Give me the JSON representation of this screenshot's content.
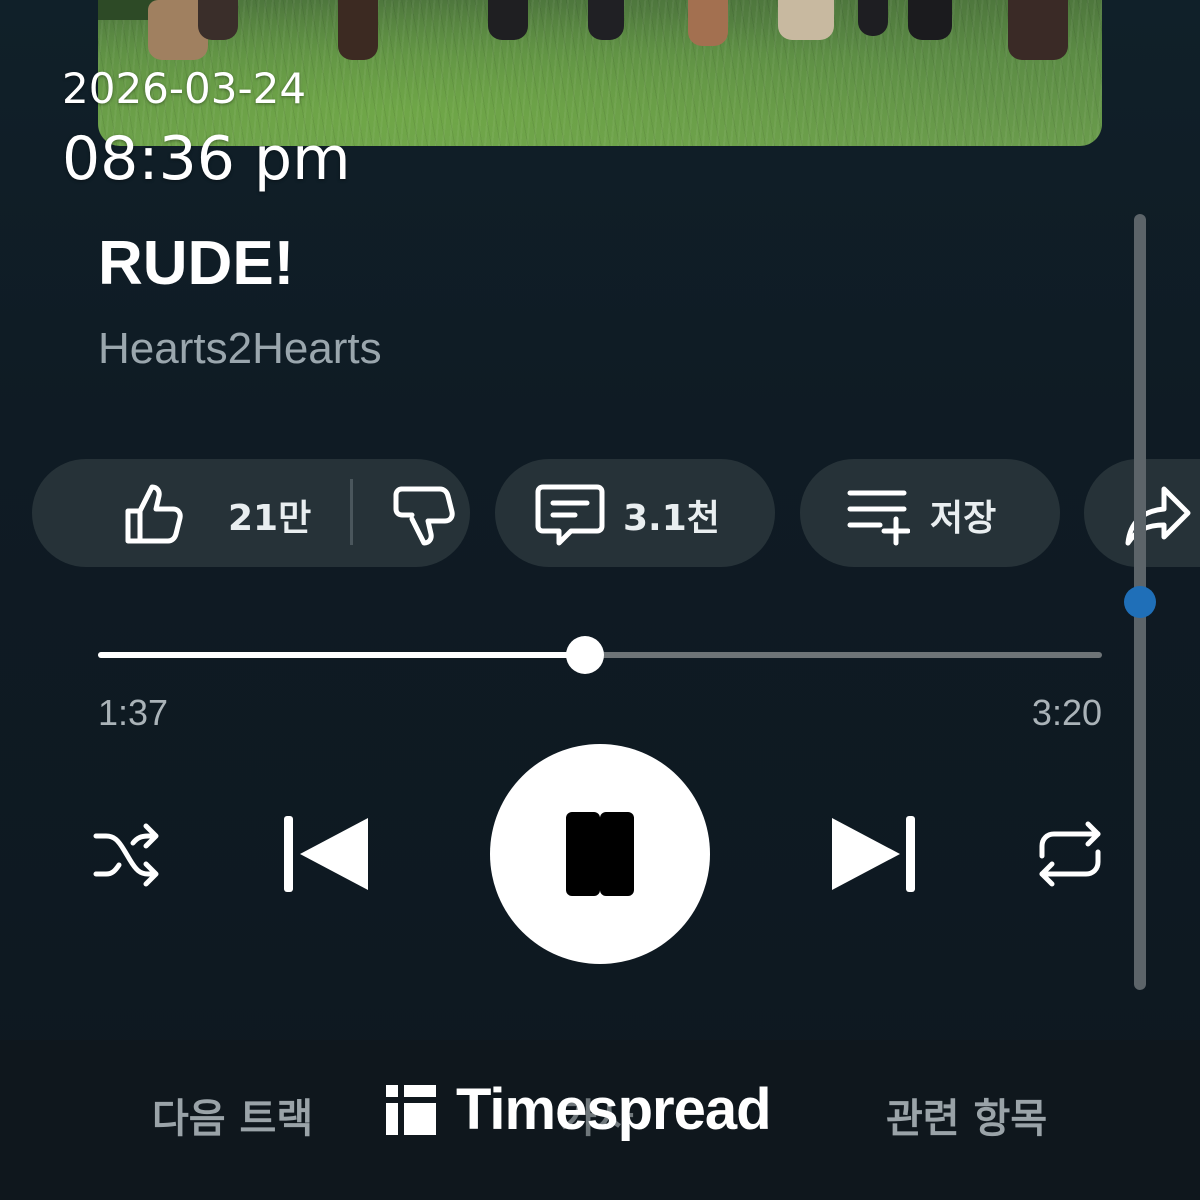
{
  "overlay": {
    "date": "2026-03-24",
    "time": "08:36 pm"
  },
  "track": {
    "title": "RUDE!",
    "artist": "Hearts2Hearts"
  },
  "actions": {
    "like_count": "21만",
    "comment_count": "3.1천",
    "save_label": "저장"
  },
  "player": {
    "elapsed": "1:37",
    "total": "3:20",
    "progress": 0.485
  },
  "bottom_tabs": {
    "next_track": "다음 트랙",
    "lyrics": "가사",
    "related": "관련 항목"
  },
  "watermark": {
    "text": "Timespread"
  },
  "colors": {
    "background": "#0f1a22",
    "chip": "#263238",
    "accent_dot": "#1f6fb8"
  },
  "icons": [
    "thumbs-up-icon",
    "thumbs-down-icon",
    "comment-icon",
    "save-playlist-icon",
    "share-icon",
    "shuffle-icon",
    "previous-icon",
    "pause-icon",
    "next-icon",
    "repeat-icon"
  ]
}
